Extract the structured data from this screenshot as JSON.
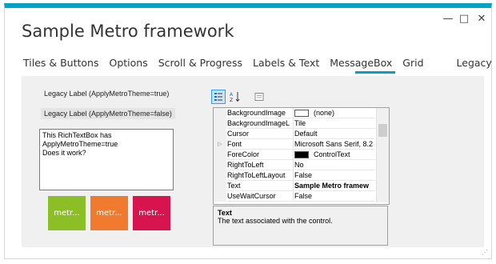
{
  "window": {
    "title": "Sample Metro framework",
    "controls": {
      "minimize": "—",
      "maximize": "□",
      "close": "✕"
    },
    "accent": "#00a3c4"
  },
  "tabs": [
    {
      "label": "Tiles & Buttons",
      "active": false
    },
    {
      "label": "Options",
      "active": false
    },
    {
      "label": "Scroll & Progress",
      "active": false
    },
    {
      "label": "Labels & Text",
      "active": false
    },
    {
      "label": "MessageBox",
      "active": false
    },
    {
      "label": "Grid",
      "active": false
    },
    {
      "label": "Legacy",
      "active": true
    }
  ],
  "legacy": {
    "label1": "Legacy Label (ApplyMetroTheme=true)",
    "label2": "Legacy Label (ApplyMetroTheme=false)",
    "richtext": {
      "line1": "This RichTextBox has",
      "line2": "ApplyMetroTheme=true",
      "line3": "Does it work?"
    },
    "tiles": [
      {
        "label": "metr...",
        "color": "#8cbf26"
      },
      {
        "label": "metr...",
        "color": "#f07b2f"
      },
      {
        "label": "metr...",
        "color": "#d8144f"
      }
    ]
  },
  "property_grid": {
    "toolbar": {
      "categorized_icon": "categorized-icon",
      "alphabetical_icon": "alphabetical-icon",
      "property_pages_icon": "property-pages-icon"
    },
    "rows": [
      {
        "name": "BackgroundImage",
        "value": "(none)",
        "swatch": "#ffffff",
        "expand": ""
      },
      {
        "name": "BackgroundImageL",
        "value": "Tile",
        "swatch": "",
        "expand": ""
      },
      {
        "name": "Cursor",
        "value": "Default",
        "swatch": "",
        "expand": ""
      },
      {
        "name": "Font",
        "value": "Microsoft Sans Serif, 8.2",
        "swatch": "",
        "expand": "▷"
      },
      {
        "name": "ForeColor",
        "value": "ControlText",
        "swatch": "#000000",
        "expand": ""
      },
      {
        "name": "RightToLeft",
        "value": "No",
        "swatch": "",
        "expand": ""
      },
      {
        "name": "RightToLeftLayout",
        "value": "False",
        "swatch": "",
        "expand": ""
      },
      {
        "name": "Text",
        "value": "Sample Metro framew",
        "swatch": "",
        "expand": "",
        "bold": true
      },
      {
        "name": "UseWaitCursor",
        "value": "False",
        "swatch": "",
        "expand": ""
      }
    ],
    "description": {
      "title": "Text",
      "body": "The text associated with the control."
    }
  }
}
